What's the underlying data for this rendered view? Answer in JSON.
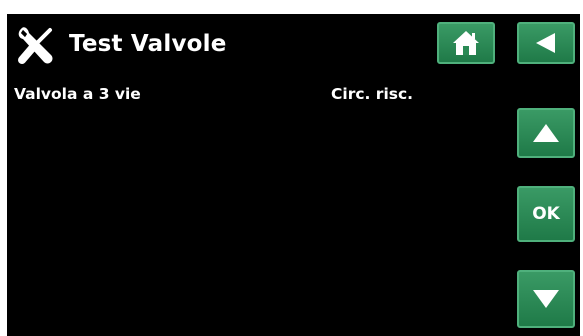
{
  "header": {
    "title": "Test Valvole",
    "title_icon": "tools-icon"
  },
  "rows": [
    {
      "label": "Valvola a 3 vie",
      "value": "Circ. risc."
    }
  ],
  "nav": {
    "home_icon": "home-icon",
    "back_icon": "back-arrow-icon",
    "up_icon": "up-arrow-icon",
    "ok_label": "OK",
    "down_icon": "down-arrow-icon"
  },
  "colors": {
    "background": "#000000",
    "text": "#ffffff",
    "button_green": "#2a8a55",
    "button_border": "#4fb07c"
  }
}
